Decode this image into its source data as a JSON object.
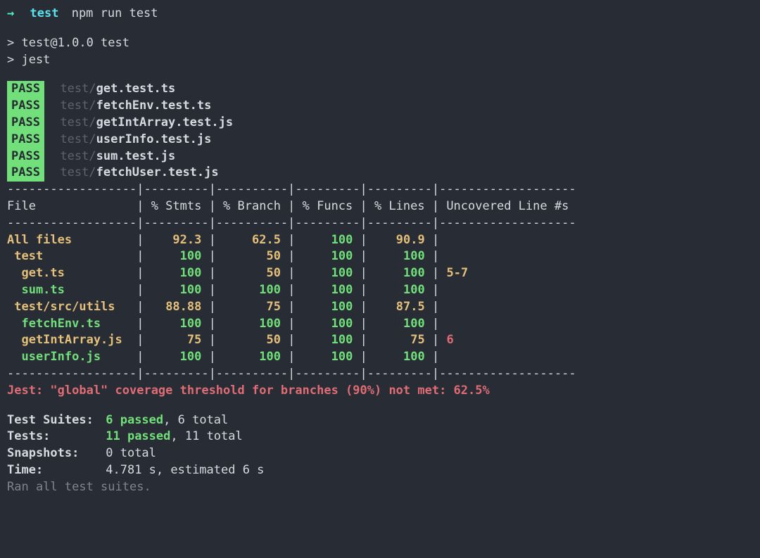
{
  "prompt": {
    "arrow": "→",
    "dir": "test",
    "command": "npm run test"
  },
  "npm_output": {
    "line1": "> test@1.0.0 test",
    "line2": "> jest"
  },
  "test_results": [
    {
      "status": "PASS",
      "path": "test/",
      "file": "get.test.ts"
    },
    {
      "status": "PASS",
      "path": "test/",
      "file": "fetchEnv.test.ts"
    },
    {
      "status": "PASS",
      "path": "test/",
      "file": "getIntArray.test.js"
    },
    {
      "status": "PASS",
      "path": "test/",
      "file": "userInfo.test.js"
    },
    {
      "status": "PASS",
      "path": "test/",
      "file": "sum.test.js"
    },
    {
      "status": "PASS",
      "path": "test/",
      "file": "fetchUser.test.js"
    }
  ],
  "coverage": {
    "headers": {
      "file": "File",
      "stmts": "% Stmts",
      "branch": "% Branch",
      "funcs": "% Funcs",
      "lines": "% Lines",
      "uncovered": "Uncovered Line #s"
    },
    "rows": [
      {
        "file": "All files",
        "indent": 0,
        "stmts": "92.3",
        "branch": "62.5",
        "funcs": "100",
        "lines": "90.9",
        "uncovered": "",
        "colors": {
          "file": "yellow",
          "stmts": "yellow",
          "branch": "yellow",
          "funcs": "green",
          "lines": "yellow",
          "uncovered": ""
        }
      },
      {
        "file": "test",
        "indent": 1,
        "stmts": "100",
        "branch": "50",
        "funcs": "100",
        "lines": "100",
        "uncovered": "",
        "colors": {
          "file": "yellow",
          "stmts": "green",
          "branch": "yellow",
          "funcs": "green",
          "lines": "green",
          "uncovered": ""
        }
      },
      {
        "file": "get.ts",
        "indent": 2,
        "stmts": "100",
        "branch": "50",
        "funcs": "100",
        "lines": "100",
        "uncovered": "5-7",
        "colors": {
          "file": "yellow",
          "stmts": "green",
          "branch": "yellow",
          "funcs": "green",
          "lines": "green",
          "uncovered": "yellow"
        }
      },
      {
        "file": "sum.ts",
        "indent": 2,
        "stmts": "100",
        "branch": "100",
        "funcs": "100",
        "lines": "100",
        "uncovered": "",
        "colors": {
          "file": "green",
          "stmts": "green",
          "branch": "green",
          "funcs": "green",
          "lines": "green",
          "uncovered": ""
        }
      },
      {
        "file": "test/src/utils",
        "indent": 1,
        "stmts": "88.88",
        "branch": "75",
        "funcs": "100",
        "lines": "87.5",
        "uncovered": "",
        "colors": {
          "file": "yellow",
          "stmts": "yellow",
          "branch": "yellow",
          "funcs": "green",
          "lines": "yellow",
          "uncovered": ""
        }
      },
      {
        "file": "fetchEnv.ts",
        "indent": 2,
        "stmts": "100",
        "branch": "100",
        "funcs": "100",
        "lines": "100",
        "uncovered": "",
        "colors": {
          "file": "green",
          "stmts": "green",
          "branch": "green",
          "funcs": "green",
          "lines": "green",
          "uncovered": ""
        }
      },
      {
        "file": "getIntArray.js",
        "indent": 2,
        "stmts": "75",
        "branch": "50",
        "funcs": "100",
        "lines": "75",
        "uncovered": "6",
        "colors": {
          "file": "yellow",
          "stmts": "yellow",
          "branch": "yellow",
          "funcs": "green",
          "lines": "yellow",
          "uncovered": "red"
        }
      },
      {
        "file": "userInfo.js",
        "indent": 2,
        "stmts": "100",
        "branch": "100",
        "funcs": "100",
        "lines": "100",
        "uncovered": "",
        "colors": {
          "file": "green",
          "stmts": "green",
          "branch": "green",
          "funcs": "green",
          "lines": "green",
          "uncovered": ""
        }
      }
    ]
  },
  "error": "Jest: \"global\" coverage threshold for branches (90%) not met: 62.5%",
  "summary": {
    "test_suites": {
      "label": "Test Suites:",
      "passed": "6 passed",
      "sep": ", ",
      "total": "6 total"
    },
    "tests": {
      "label": "Tests:",
      "passed": "11 passed",
      "sep": ", ",
      "total": "11 total"
    },
    "snapshots": {
      "label": "Snapshots:",
      "value": "0 total"
    },
    "time": {
      "label": "Time:",
      "value": "4.781 s, estimated 6 s"
    },
    "ran": "Ran all test suites."
  }
}
